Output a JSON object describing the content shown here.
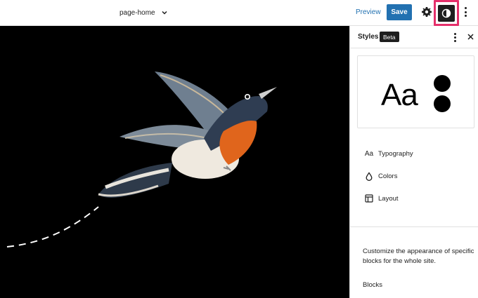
{
  "header": {
    "document_title": "page-home",
    "preview_label": "Preview",
    "save_label": "Save",
    "accent_color": "#2271b1",
    "highlight_color": "#e5306b"
  },
  "icons": {
    "title_dropdown": "chevron-down-icon",
    "settings": "gear-icon",
    "styles_toggle": "half-circle-contrast-icon",
    "options": "more-vertical-icon",
    "close": "close-icon"
  },
  "canvas": {
    "background": "#000000",
    "image": "hummingbird illustration with dashed flight path"
  },
  "sidebar": {
    "title": "Styles",
    "badge": "Beta",
    "preview_text": "Aa",
    "nav_items": [
      {
        "icon": "Aa",
        "label": "Typography"
      },
      {
        "icon": "droplet-icon",
        "label": "Colors"
      },
      {
        "icon": "layout-icon",
        "label": "Layout"
      }
    ],
    "description": "Customize the appearance of specific blocks for the whole site.",
    "blocks_label": "Blocks"
  }
}
